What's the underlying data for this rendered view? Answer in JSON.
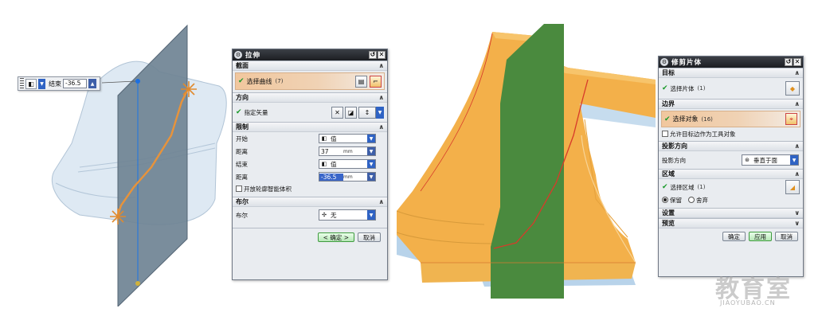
{
  "mini_toolbar": {
    "label": "结束",
    "value": "-36.5"
  },
  "extrude_dialog": {
    "title": "拉伸",
    "sections": {
      "section": {
        "label": "截面",
        "select_curve": "选择曲线",
        "count": "(7)"
      },
      "direction": {
        "label": "方向",
        "specify_vector": "指定矢量"
      },
      "limits": {
        "label": "限制",
        "start_label": "开始",
        "start_value": "值",
        "start_distance_label": "距离",
        "start_distance": "37",
        "end_label": "结束",
        "end_value": "值",
        "end_distance_label": "距离",
        "end_distance": "-36.5",
        "unit": "mm",
        "open_profile_label": "开放轮廓智能体积"
      },
      "boolean": {
        "label": "布尔",
        "field_label": "布尔",
        "value": "无"
      }
    },
    "ok": "< 确定 >",
    "cancel": "取消"
  },
  "trim_dialog": {
    "title": "修剪片体",
    "sections": {
      "target": {
        "label": "目标",
        "select_sheet": "选择片体",
        "count": "(1)"
      },
      "boundary": {
        "label": "边界",
        "select_object": "选择对象",
        "count": "(16)",
        "allow_label": "允许目标边作为工具对象"
      },
      "projection": {
        "label": "投影方向",
        "field_label": "投影方向",
        "value": "垂直于面"
      },
      "region": {
        "label": "区域",
        "select_region": "选择区域",
        "count": "(1)",
        "keep": "保留",
        "discard": "舍弃"
      },
      "settings": {
        "label": "设置"
      },
      "preview": {
        "label": "预览"
      }
    },
    "ok": "确定",
    "apply": "应用",
    "cancel": "取消"
  },
  "watermark": {
    "logo": "教育室",
    "url": "JIAOYUBAO.CN"
  },
  "colors": {
    "plane_gray": "#6f8394",
    "plane_green": "#4a8a3e",
    "surface_orange": "#f3b04a",
    "surface_blue": "#b8d3ea",
    "highlight_orange": "#f1c79e"
  }
}
